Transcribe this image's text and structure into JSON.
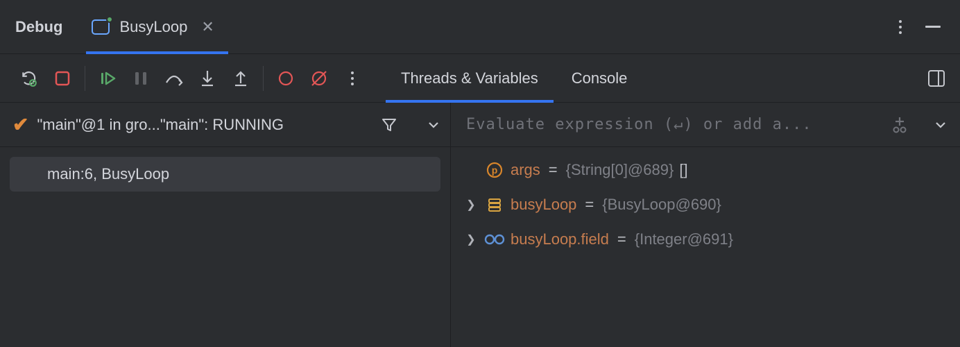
{
  "window": {
    "title": "Debug"
  },
  "config_tab": {
    "label": "BusyLoop"
  },
  "sub_tabs": {
    "threads": "Threads & Variables",
    "console": "Console"
  },
  "thread_bar": {
    "text": "\"main\"@1 in gro...\"main\": RUNNING"
  },
  "frames": [
    {
      "label": "main:6, BusyLoop"
    }
  ],
  "evaluate": {
    "placeholder": "Evaluate expression (↵) or add a..."
  },
  "variables": [
    {
      "icon": "p",
      "expandable": false,
      "name": "args",
      "value": "{String[0]@689}",
      "tail": " []"
    },
    {
      "icon": "stack",
      "expandable": true,
      "name": "busyLoop",
      "value": "{BusyLoop@690}",
      "tail": ""
    },
    {
      "icon": "glasses",
      "expandable": true,
      "name": "busyLoop.field",
      "value": "{Integer@691}",
      "tail": ""
    }
  ],
  "icons": {
    "rerun": "rerun-icon",
    "stop": "stop-icon",
    "resume": "resume-icon",
    "pause": "pause-icon",
    "step_over": "step-over-icon",
    "step_into": "step-into-icon",
    "step_out": "step-out-icon",
    "view_bp": "view-breakpoints-icon",
    "mute_bp": "mute-breakpoints-icon"
  }
}
